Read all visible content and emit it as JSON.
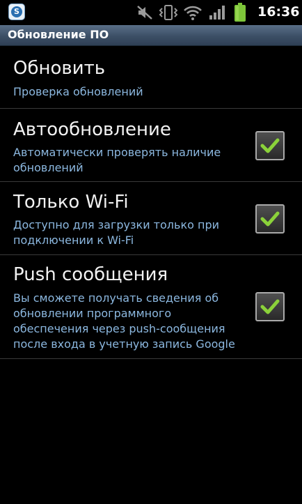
{
  "status_bar": {
    "time": "16:36",
    "icons": [
      "app-s-icon",
      "mute-icon",
      "vibrate-icon",
      "wifi-icon",
      "signal-icon",
      "battery-icon"
    ]
  },
  "title_bar": {
    "title": "Обновление ПО"
  },
  "items": [
    {
      "title": "Обновить",
      "summary": "Проверка обновлений",
      "has_checkbox": false
    },
    {
      "title": "Автообновление",
      "summary": "Автоматически проверять наличие обновлений",
      "has_checkbox": true,
      "checked": true
    },
    {
      "title": "Только Wi-Fi",
      "summary": "Доступно для загрузки только при подключении к Wi-Fi",
      "has_checkbox": true,
      "checked": true
    },
    {
      "title": "Push сообщения",
      "summary": "Вы сможете получать сведения об обновлении программного обеспечения через push-сообщения после входа в учетную запись Google",
      "has_checkbox": true,
      "checked": true
    }
  ],
  "colors": {
    "summary_text": "#8cb8e0",
    "check_green": "#8bd23a",
    "battery_green": "#7ec63a"
  }
}
